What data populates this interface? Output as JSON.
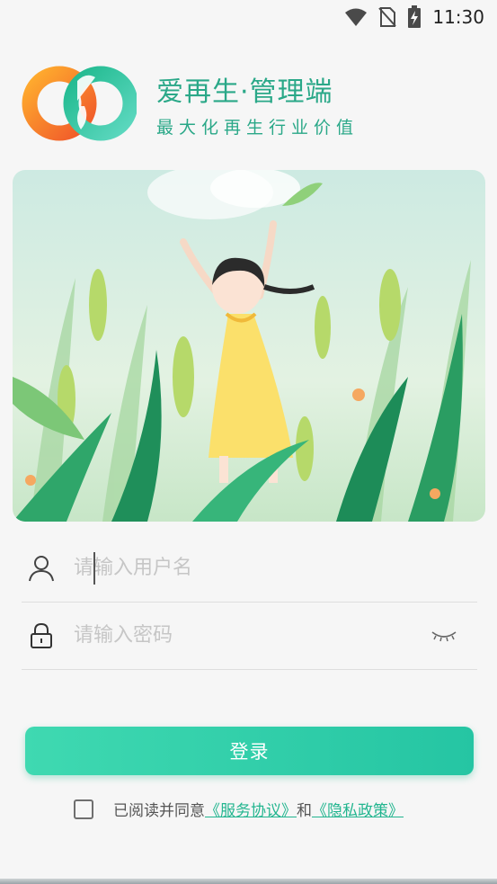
{
  "status_bar": {
    "time": "11:30",
    "icons": [
      "wifi-icon",
      "no-sim-icon",
      "battery-charging-icon"
    ]
  },
  "brand": {
    "title": "爱再生·管理端",
    "subtitle": "最大化再生行业价值"
  },
  "form": {
    "username_placeholder": "请输入用户名",
    "username_value": "",
    "password_placeholder": "请输入密码",
    "password_value": "",
    "username_icon": "user-icon",
    "password_icon": "lock-icon",
    "visibility_icon": "eye-closed-icon"
  },
  "login_button": {
    "label": "登录"
  },
  "agreement": {
    "checked": false,
    "prefix": "已阅读并同意",
    "service_link": "《服务协议》",
    "and": "和",
    "privacy_link": "《隐私政策》"
  },
  "colors": {
    "accent": "#2aa888",
    "button_start": "#3fd9b1",
    "button_end": "#25c5a3",
    "link": "#22b58f"
  }
}
